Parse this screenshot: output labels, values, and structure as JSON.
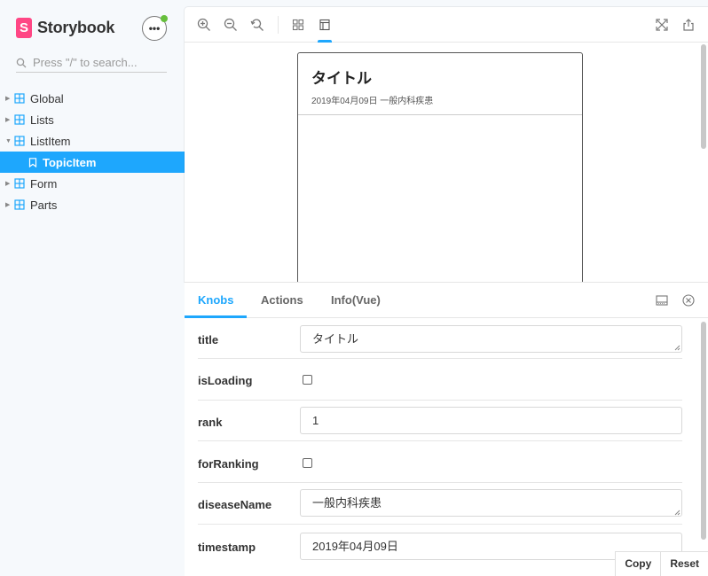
{
  "sidebar": {
    "brand_logo": "S",
    "brand_name": "Storybook",
    "menu_label": "•••",
    "search_placeholder": "Press \"/\" to search...",
    "items": [
      {
        "label": "Global"
      },
      {
        "label": "Lists"
      },
      {
        "label": "ListItem"
      },
      {
        "label": "TopicItem"
      },
      {
        "label": "Form"
      },
      {
        "label": "Parts"
      }
    ]
  },
  "preview": {
    "card": {
      "title": "タイトル",
      "meta": "2019年04月09日 一般内科疾患"
    }
  },
  "addons": {
    "tabs": [
      {
        "label": "Knobs"
      },
      {
        "label": "Actions"
      },
      {
        "label": "Info(Vue)"
      }
    ],
    "knobs": [
      {
        "label": "title",
        "value": "タイトル"
      },
      {
        "label": "isLoading"
      },
      {
        "label": "rank",
        "value": "1"
      },
      {
        "label": "forRanking"
      },
      {
        "label": "diseaseName",
        "value": "一般内科疾患"
      },
      {
        "label": "timestamp",
        "value": "2019年04月09日"
      }
    ],
    "copy_label": "Copy",
    "reset_label": "Reset"
  },
  "colors": {
    "accent": "#1ea7fd",
    "brand": "#ff4785",
    "status_dot": "#66bf3c"
  }
}
